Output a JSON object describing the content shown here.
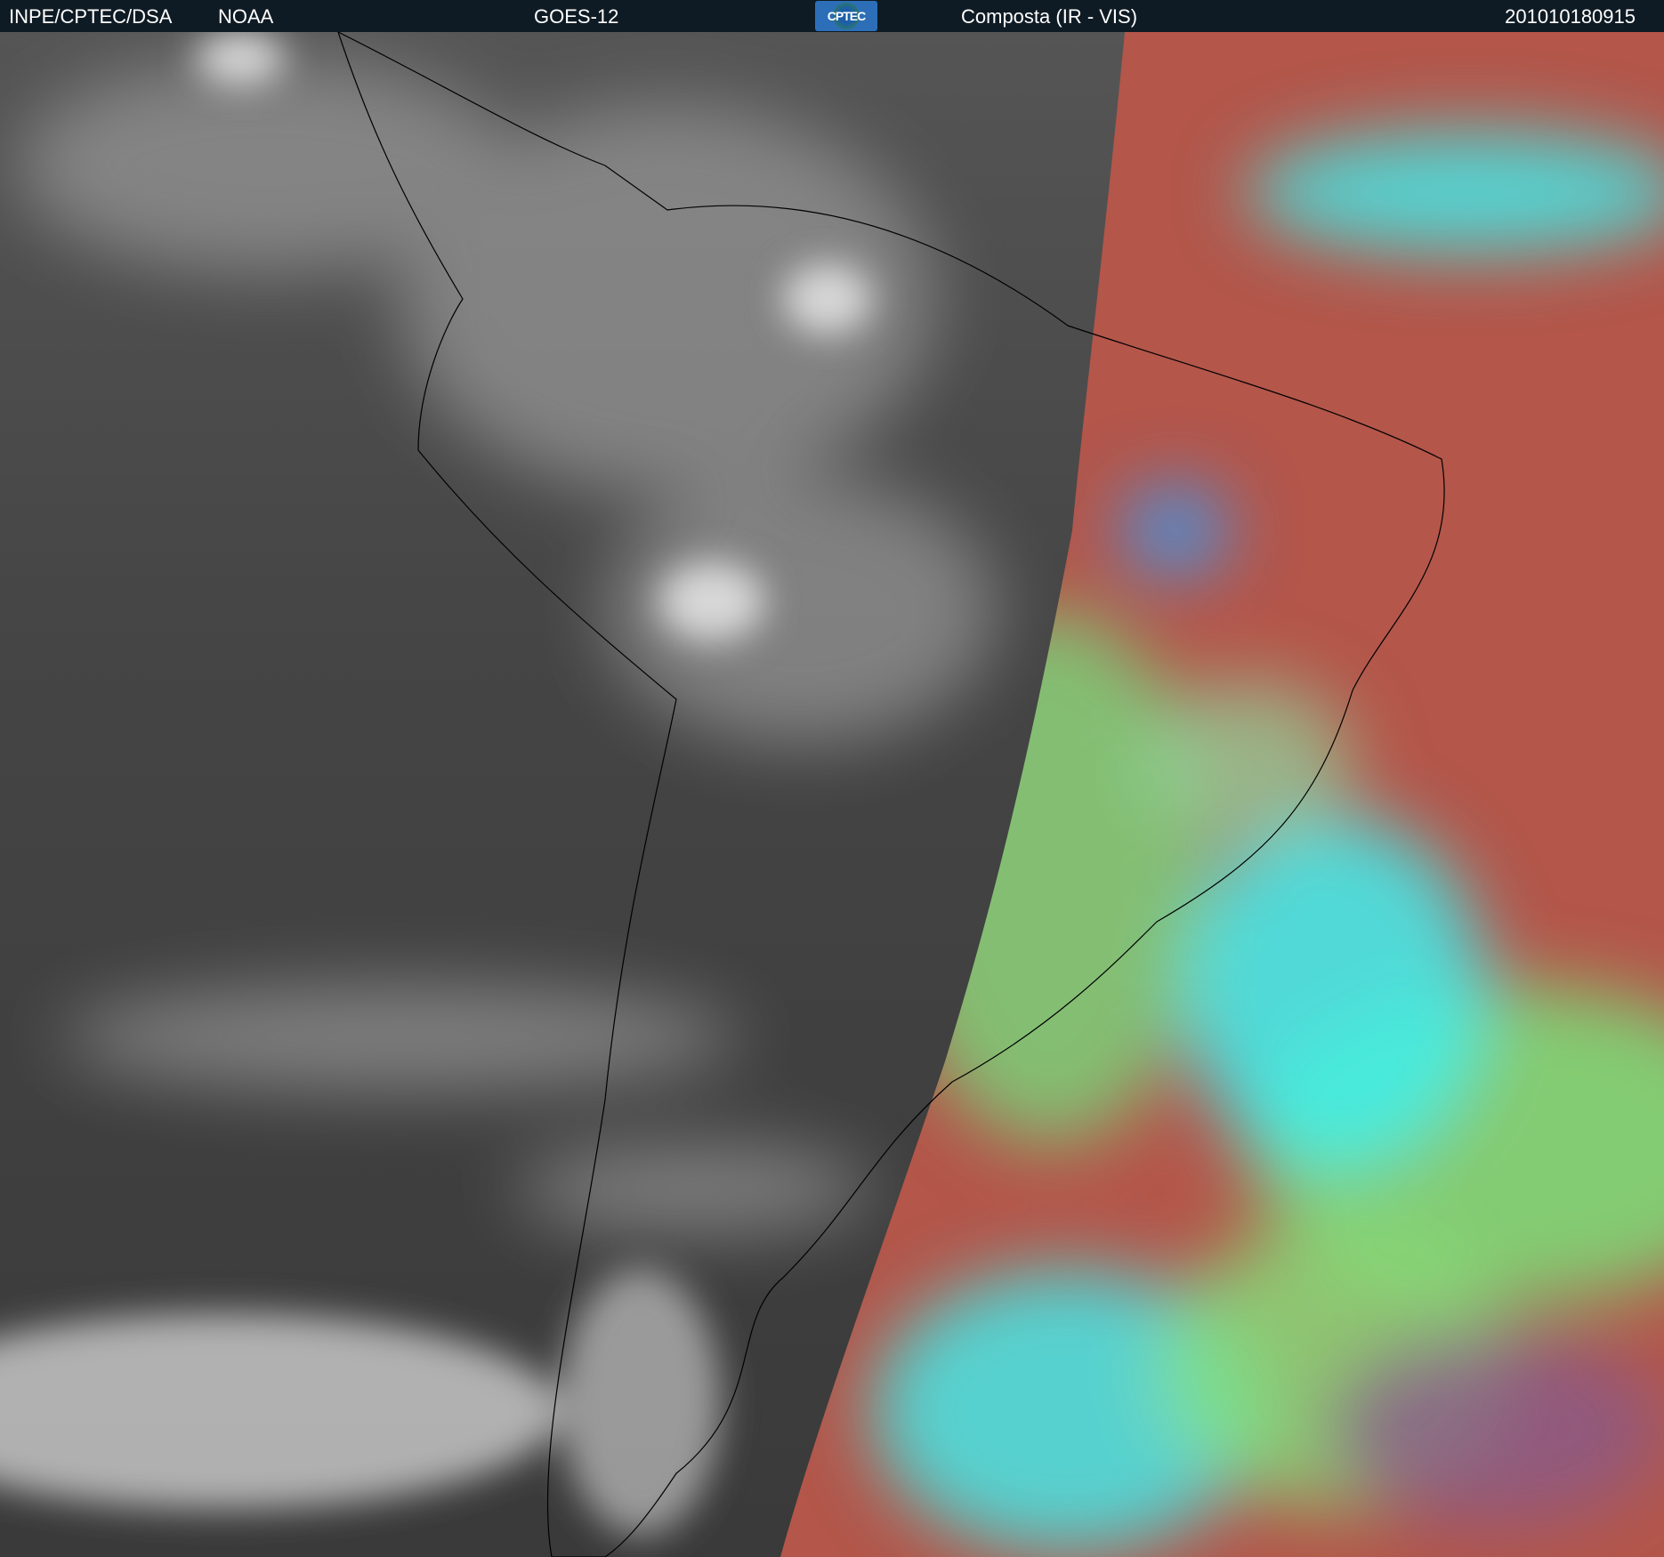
{
  "header": {
    "source": "INPE/CPTEC/DSA",
    "agency": "NOAA",
    "satellite": "GOES-12",
    "logo_text": "CPTEC",
    "product": "Composta (IR - VIS)",
    "timestamp": "201010180915"
  },
  "colors": {
    "header_bg": "#0f1b24",
    "night_gray": "#3e3e3e",
    "day_red": "#b4564a",
    "day_cyan": "#3ef0f0",
    "day_green": "#7be07a"
  }
}
